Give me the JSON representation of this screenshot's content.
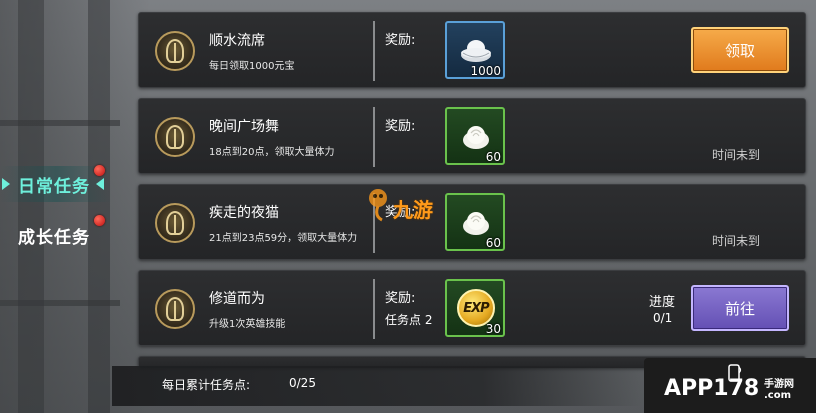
{
  "colors": {
    "active_tab": "#6ef0dc",
    "claim_button": "#e8891f",
    "go_button": "#7a66c6",
    "blue_item_border": "#5aa0d8",
    "green_item_border": "#6ac24c",
    "red_dot": "#e02020"
  },
  "tabs": [
    {
      "label": "日常任务",
      "active": true,
      "badge": "red-dot"
    },
    {
      "label": "成长任务",
      "active": false,
      "badge": "red-dot"
    }
  ],
  "tasks": [
    {
      "title": "顺水流席",
      "desc": "每日领取1000元宝",
      "reward_label": "奖励:",
      "reward_item": "silver-ingot-icon",
      "reward_count": "1000",
      "action": "领取"
    },
    {
      "title": "晚间广场舞",
      "desc": "18点到20点，领取大量体力",
      "reward_label": "奖励:",
      "reward_item": "steamed-bun-icon",
      "reward_count": "60",
      "status": "时间未到"
    },
    {
      "title": "疾走的夜猫",
      "desc": "21点到23点59分，领取大量体力",
      "reward_label": "奖励:",
      "reward_item": "steamed-bun-icon",
      "reward_count": "60",
      "status": "时间未到"
    },
    {
      "title": "修道而为",
      "desc": "升级1次英雄技能",
      "reward_label": "奖励:",
      "task_points": "任务点 2",
      "reward_item": "exp-icon",
      "reward_item_text": "EXP",
      "reward_count": "30",
      "progress_label": "进度",
      "progress_value": "0/1",
      "action": "前往"
    }
  ],
  "footer": {
    "label": "每日累计任务点:",
    "value": "0/25"
  },
  "watermarks": {
    "center": "九游",
    "corner_main": "APP178",
    "corner_sub": "手游网",
    "corner_domain": ".com"
  }
}
